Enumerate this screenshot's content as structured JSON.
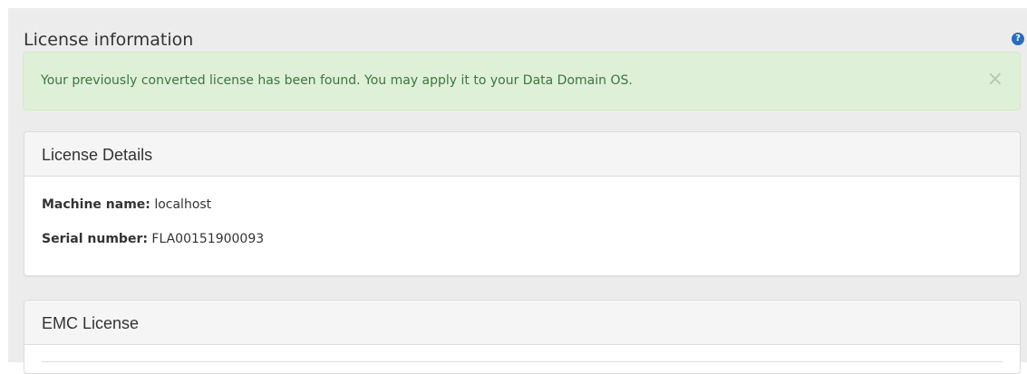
{
  "page": {
    "title": "License information",
    "help_icon": "help-icon",
    "help_glyph": "?"
  },
  "alert": {
    "message": "Your previously converted license has been found. You may apply it to your Data Domain OS.",
    "close_glyph": "×",
    "colors": {
      "background": "#dff0d8",
      "text": "#3c763d"
    }
  },
  "license_details": {
    "heading": "License Details",
    "machine_name_label": "Machine name:",
    "machine_name_value": "localhost",
    "serial_number_label": "Serial number:",
    "serial_number_value": "FLA00151900093"
  },
  "emc_license": {
    "heading": "EMC License"
  }
}
